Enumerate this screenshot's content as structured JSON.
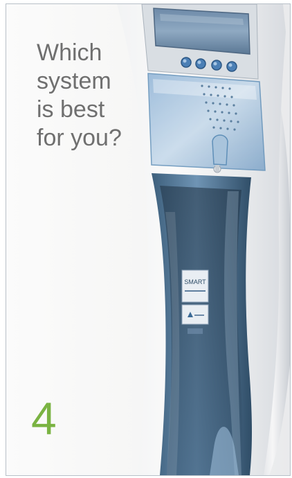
{
  "headline": {
    "lines": [
      "Which",
      "system",
      "is best",
      "for you?"
    ]
  },
  "page_number": "4",
  "device_panel": {
    "buttons": [
      "",
      "",
      "",
      ""
    ]
  },
  "labels": {
    "smart_card": "SMART"
  },
  "colors": {
    "headline": "#6f6f6f",
    "page_number": "#7ab342",
    "device_blue": "#5f8fb8",
    "device_body": "#eef0f2"
  }
}
